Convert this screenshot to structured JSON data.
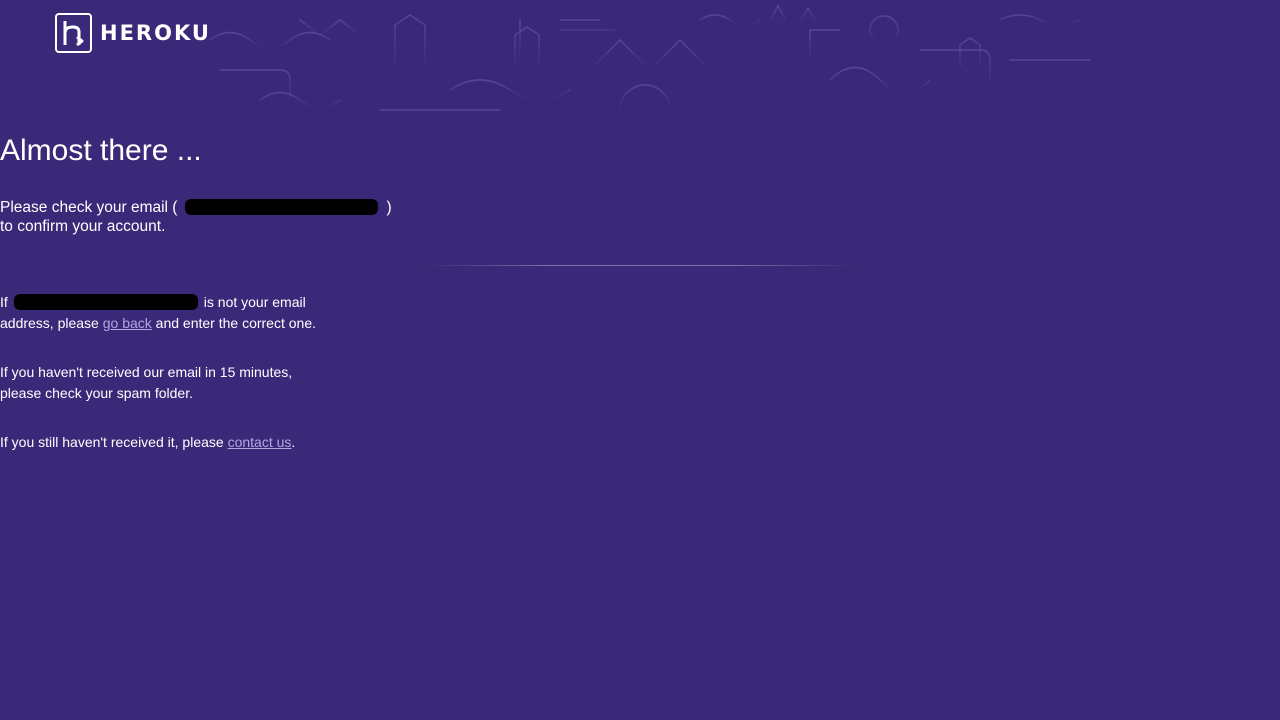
{
  "brand": {
    "name": "HEROKU",
    "logo_icon": "heroku-logo-icon"
  },
  "colors": {
    "background": "#3a2878",
    "link": "#b2a7e0",
    "redaction": "#000000"
  },
  "content": {
    "headline": "Almost there ...",
    "confirm": {
      "prefix": "Please check your email (",
      "suffix": ")",
      "line2": "to confirm your account."
    },
    "wrong_email": {
      "prefix": "If",
      "suffix": "is not your email",
      "line2_prefix": "address, please",
      "link": "go back",
      "line2_suffix": "and enter the correct one."
    },
    "spam": {
      "line1": "If you haven't received our email in 15 minutes,",
      "line2": "please check your spam folder."
    },
    "contact": {
      "prefix": "If you still haven't received it, please",
      "link": "contact us",
      "suffix": "."
    }
  }
}
